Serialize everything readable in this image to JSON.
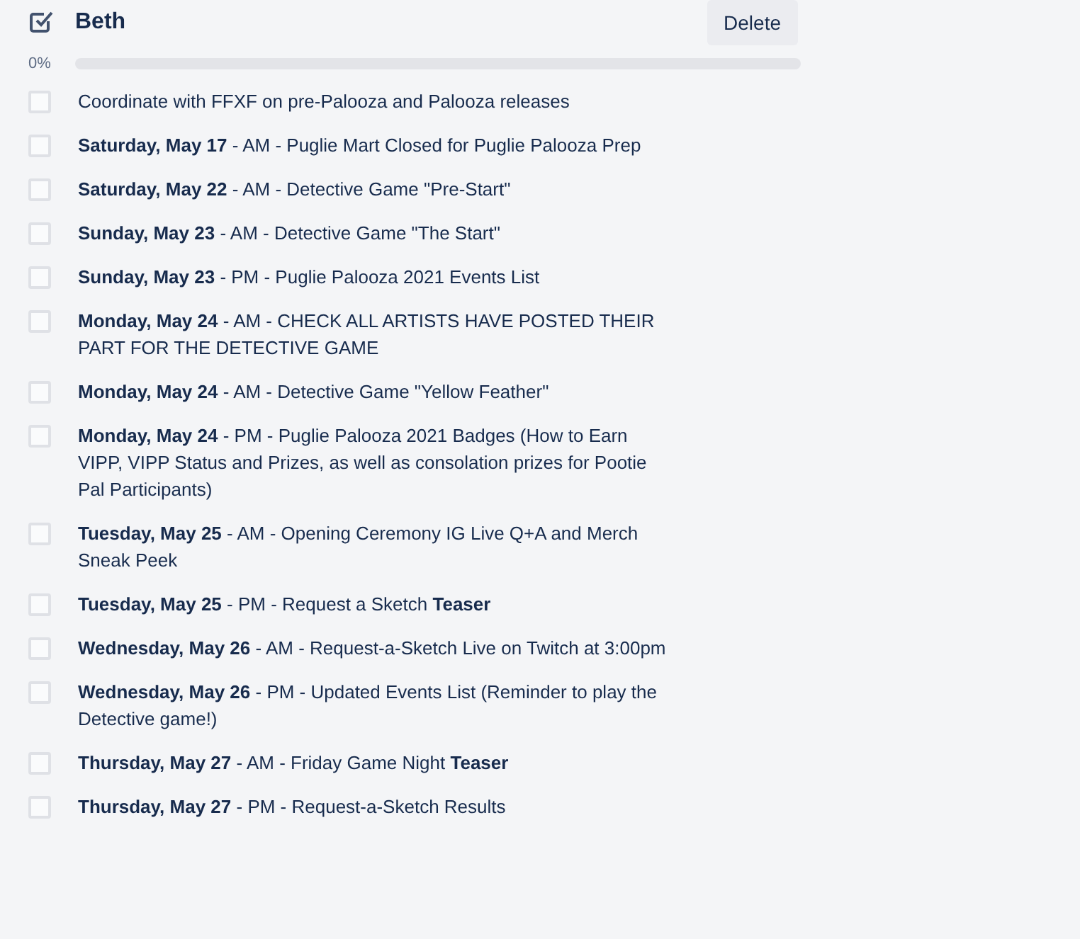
{
  "checklist": {
    "title": "Beth",
    "delete_button": "Delete",
    "progress_label": "0%",
    "level": 0,
    "items": [
      {
        "text": "Coordinate with FFXF on pre-Palooza and Palooza releases",
        "checked": false
      },
      {
        "text": "**Saturday, May 17** - AM - Puglie Mart Closed for Puglie Palooza Prep",
        "checked": false
      },
      {
        "text": "**Saturday, May 22** - AM - Detective Game \"Pre-Start\"",
        "checked": false
      },
      {
        "text": "**Sunday, May 23** - AM - Detective Game \"The Start\"",
        "checked": false
      },
      {
        "text": "**Sunday, May 23** - PM - Puglie Palooza 2021 Events List",
        "checked": false
      },
      {
        "text": "**Monday, May 24** - AM - CHECK ALL ARTISTS HAVE POSTED THEIR PART FOR THE DETECTIVE GAME",
        "checked": false
      },
      {
        "text": "**Monday, May 24** - AM - Detective Game \"Yellow Feather\"",
        "checked": false
      },
      {
        "text": "**Monday, May 24** - PM - Puglie Palooza 2021 Badges (How to Earn VIPP, VIPP Status and Prizes, as well as consolation prizes for Pootie Pal Participants)",
        "checked": false
      },
      {
        "text": "**Tuesday, May 25** - AM - Opening Ceremony IG Live Q+A and Merch Sneak Peek",
        "checked": false
      },
      {
        "text": "**Tuesday, May 25** - PM - Request a Sketch **Teaser**",
        "checked": false
      },
      {
        "text": "**Wednesday, May 26** - AM - Request-a-Sketch Live on Twitch at 3:00pm",
        "checked": false
      },
      {
        "text": "**Wednesday, May 26** - PM - Updated Events List (Reminder to play the Detective game!)",
        "checked": false
      },
      {
        "text": "**Thursday, May 27** - AM - Friday Game Night **Teaser**",
        "checked": false
      },
      {
        "text": "**Thursday, May 27** - PM - Request-a-Sketch Results",
        "checked": false
      }
    ]
  }
}
